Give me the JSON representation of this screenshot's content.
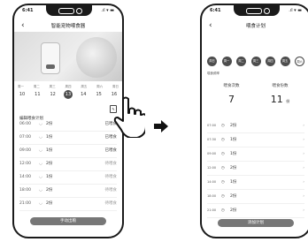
{
  "left_screen": {
    "status_time": "6:41",
    "status_icons": ".ıl ▾ ▬",
    "back_icon": "‹",
    "title": "智能宠物喂食器",
    "day_labels": [
      "周一",
      "周二",
      "周三",
      "周四",
      "周五",
      "周六",
      "周日"
    ],
    "day_dates": [
      "10",
      "11",
      "12",
      "13",
      "14",
      "15",
      "16"
    ],
    "selected_day_index": 3,
    "section_title": "编辑喂食计划",
    "edit_icon": "edit-icon",
    "rows": [
      {
        "time": "06:00",
        "portion": "2份",
        "status": "已喂食",
        "done": true
      },
      {
        "time": "07:00",
        "portion": "1份",
        "status": "已喂食",
        "done": true
      },
      {
        "time": "09:00",
        "portion": "1份",
        "status": "已喂食",
        "done": true
      },
      {
        "time": "12:00",
        "portion": "2份",
        "status": "待喂食",
        "done": false
      },
      {
        "time": "14:00",
        "portion": "1份",
        "status": "待喂食",
        "done": false
      },
      {
        "time": "18:00",
        "portion": "2份",
        "status": "待喂食",
        "done": false
      },
      {
        "time": "21:00",
        "portion": "2份",
        "status": "待喂食",
        "done": false
      }
    ],
    "cta_label": "手动出粮"
  },
  "right_screen": {
    "status_time": "6:41",
    "status_icons": ".ıl ▾ ▬",
    "back_icon": "‹",
    "title": "喂食计划",
    "weekdays": [
      "周日",
      "周一",
      "周二",
      "周三",
      "周四",
      "周五",
      "周六"
    ],
    "weekday_active": [
      true,
      true,
      true,
      true,
      true,
      true,
      false
    ],
    "settings_label": "喂食频率",
    "count_label": "喂食次数",
    "count_value": "7",
    "portion_label": "喂食份数",
    "portion_value": "11",
    "portion_unit": "份",
    "rows": [
      {
        "time": "07:00",
        "portion": "2份"
      },
      {
        "time": "07:30",
        "portion": "1份"
      },
      {
        "time": "09:00",
        "portion": "1份"
      },
      {
        "time": "12:00",
        "portion": "2份"
      },
      {
        "time": "14:00",
        "portion": "1份"
      },
      {
        "time": "18:00",
        "portion": "2份"
      },
      {
        "time": "21:00",
        "portion": "2份"
      }
    ],
    "cta_label": "添加计划"
  }
}
